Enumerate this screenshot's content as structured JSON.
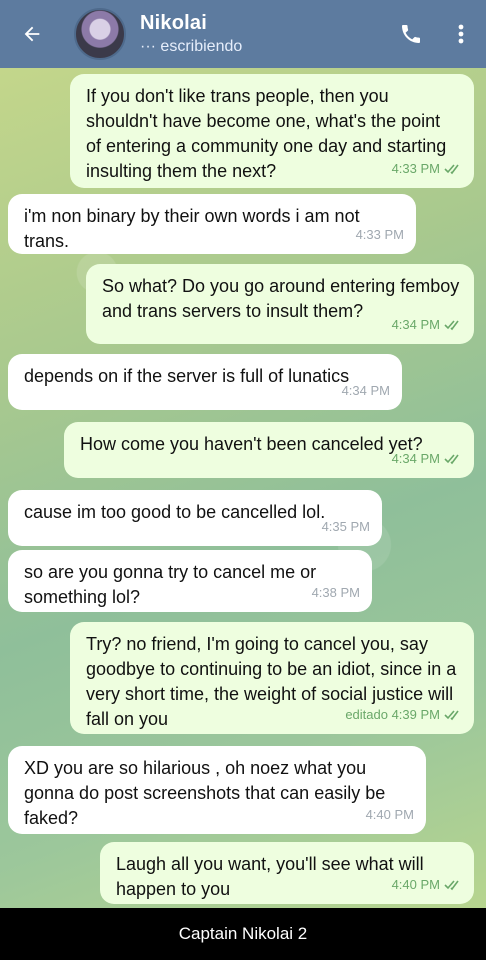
{
  "header": {
    "name": "Nikolai",
    "status": "··· escribiendo",
    "icons": [
      "back-arrow-icon",
      "phone-icon",
      "more-vert-icon"
    ],
    "colors": {
      "bar": "#5d7b9f",
      "incoming": "#ffffff",
      "outgoing": "#eefedf"
    }
  },
  "messages": [
    {
      "dir": "out",
      "text": "If you don't like trans people, then you shouldn't have become one, what's the point of entering a community one day and starting insulting them the next?",
      "time": "4:33 PM",
      "read": true
    },
    {
      "dir": "in",
      "text": "i'm non binary by their own words i am not trans.",
      "time": "4:33 PM"
    },
    {
      "dir": "out",
      "text": "So what? Do you go around entering femboy and trans servers to insult them?",
      "time": "4:34 PM",
      "read": true
    },
    {
      "dir": "in",
      "text": "depends on if the server is full of lunatics",
      "time": "4:34 PM"
    },
    {
      "dir": "out",
      "text": "How come you haven't been canceled yet?",
      "time": "4:34 PM",
      "read": true
    },
    {
      "dir": "in",
      "text": "cause im too good to be cancelled lol.",
      "time": "4:35 PM"
    },
    {
      "dir": "in",
      "text": "so are you gonna try to cancel me or something lol?",
      "time": "4:38 PM"
    },
    {
      "dir": "out",
      "text": "Try? no friend, I'm going to cancel you, say goodbye to continuing to be an idiot, since in a very short time, the weight of social justice will fall on you",
      "time": "editado 4:39 PM",
      "read": true
    },
    {
      "dir": "in",
      "text": "XD you are so  hilarious , oh noez what you gonna do  post screenshots that can easily be faked?",
      "time": "4:40 PM"
    },
    {
      "dir": "out",
      "text": "Laugh all you want, you'll see what will happen to you",
      "time": "4:40 PM",
      "read": true
    }
  ],
  "caption": "Captain Nikolai 2"
}
